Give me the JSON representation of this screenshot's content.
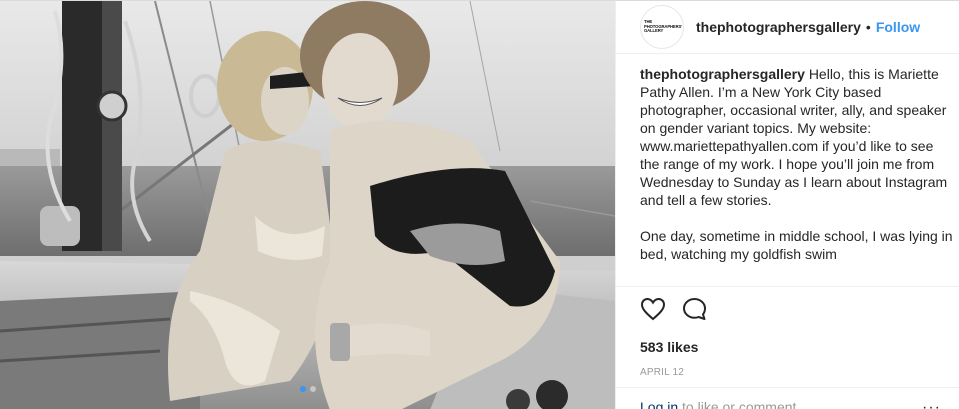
{
  "header": {
    "avatar_text": "THE\nPHOTOGRAPHERS'\nGALLERY",
    "username": "thephotographersgallery",
    "separator": "•",
    "follow_label": "Follow"
  },
  "caption": {
    "username": "thephotographersgallery",
    "paragraphs": [
      "Hello, this is Mariette Pathy Allen. I’m a New York City based photographer, occasional writer, ally, and speaker on gender variant topics. My website: www.mariettepathyallen.com if you’d like to see the range of my work. I hope you’ll join me from Wednesday to Sunday as I learn about Instagram and tell a few stories.",
      "One day, sometime in middle school, I was lying in bed, watching my goldfish swim"
    ]
  },
  "actions": {
    "like_icon": "heart-icon",
    "comment_icon": "comment-icon"
  },
  "likes_text": "583 likes",
  "date_text": "APRIL 12",
  "login": {
    "link": "Log in",
    "rest": " to like or comment."
  },
  "more_icon": "···",
  "carousel": {
    "count": 2,
    "active": 1
  },
  "colors": {
    "accent": "#3897f0",
    "text": "#262626",
    "muted": "#999999",
    "link_dark": "#003569"
  }
}
